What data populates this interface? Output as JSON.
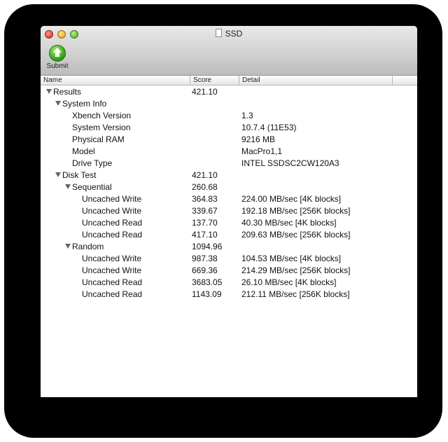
{
  "window": {
    "title": "SSD"
  },
  "toolbar": {
    "submit_label": "Submit"
  },
  "columns": {
    "name": "Name",
    "score": "Score",
    "detail": "Detail"
  },
  "rows": [
    {
      "name": "Results",
      "score": "421.10",
      "detail": ""
    },
    {
      "name": "System Info",
      "score": "",
      "detail": ""
    },
    {
      "name": "Xbench Version",
      "score": "",
      "detail": "1.3"
    },
    {
      "name": "System Version",
      "score": "",
      "detail": "10.7.4 (11E53)"
    },
    {
      "name": "Physical RAM",
      "score": "",
      "detail": "9216 MB"
    },
    {
      "name": "Model",
      "score": "",
      "detail": "MacPro1,1"
    },
    {
      "name": "Drive Type",
      "score": "",
      "detail": "INTEL SSDSC2CW120A3"
    },
    {
      "name": "Disk Test",
      "score": "421.10",
      "detail": ""
    },
    {
      "name": "Sequential",
      "score": "260.68",
      "detail": ""
    },
    {
      "name": "Uncached Write",
      "score": "364.83",
      "detail": "224.00 MB/sec [4K blocks]"
    },
    {
      "name": "Uncached Write",
      "score": "339.67",
      "detail": "192.18 MB/sec [256K blocks]"
    },
    {
      "name": "Uncached Read",
      "score": "137.70",
      "detail": "40.30 MB/sec [4K blocks]"
    },
    {
      "name": "Uncached Read",
      "score": "417.10",
      "detail": "209.63 MB/sec [256K blocks]"
    },
    {
      "name": "Random",
      "score": "1094.96",
      "detail": ""
    },
    {
      "name": "Uncached Write",
      "score": "987.38",
      "detail": "104.53 MB/sec [4K blocks]"
    },
    {
      "name": "Uncached Write",
      "score": "669.36",
      "detail": "214.29 MB/sec [256K blocks]"
    },
    {
      "name": "Uncached Read",
      "score": "3683.05",
      "detail": "26.10 MB/sec [4K blocks]"
    },
    {
      "name": "Uncached Read",
      "score": "1143.09",
      "detail": "212.11 MB/sec [256K blocks]"
    }
  ]
}
